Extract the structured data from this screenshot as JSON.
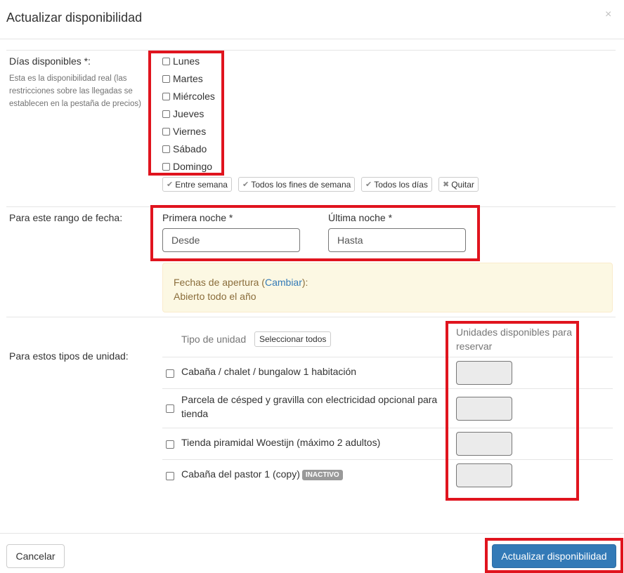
{
  "modal": {
    "title": "Actualizar disponibilidad",
    "close_icon": "×"
  },
  "days_section": {
    "label": "Días disponibles *:",
    "help": "Esta es la disponibilidad real (las restricciones sobre las llegadas se establecen en la pestaña de precios)",
    "days": [
      "Lunes",
      "Martes",
      "Miércoles",
      "Jueves",
      "Viernes",
      "Sábado",
      "Domingo"
    ],
    "quick": [
      {
        "label": "Entre semana",
        "icon": "check-icon"
      },
      {
        "label": "Todos los fines de semana",
        "icon": "check-icon"
      },
      {
        "label": "Todos los días",
        "icon": "check-icon"
      },
      {
        "label": "Quitar",
        "icon": "x-icon"
      }
    ]
  },
  "date_section": {
    "label": "Para este rango de fecha:",
    "first_label": "Primera noche *",
    "last_label": "Última noche *",
    "first_placeholder": "Desde",
    "last_placeholder": "Hasta",
    "alert": {
      "prefix": "Fechas de apertura (",
      "link": "Cambiar",
      "suffix": "):",
      "line2": "Abierto todo el año"
    }
  },
  "units_section": {
    "label": "Para estos tipos de unidad:",
    "col_type": "Tipo de unidad",
    "select_all": "Seleccionar todos",
    "col_units": "Unidades disponibles para reservar",
    "units": [
      {
        "name": "Cabaña / chalet / bungalow 1 habitación"
      },
      {
        "name": "Parcela de césped y gravilla con electricidad opcional para tienda"
      },
      {
        "name": "Tienda piramidal Woestijn (máximo 2 adultos)"
      },
      {
        "name": "Cabaña del pastor 1 (copy)",
        "badge": "INACTIVO"
      }
    ]
  },
  "footer": {
    "cancel": "Cancelar",
    "submit": "Actualizar disponibilidad"
  },
  "colors": {
    "primary": "#337ab7",
    "highlight": "#e0141e",
    "alert_bg": "#fcf8e3"
  }
}
